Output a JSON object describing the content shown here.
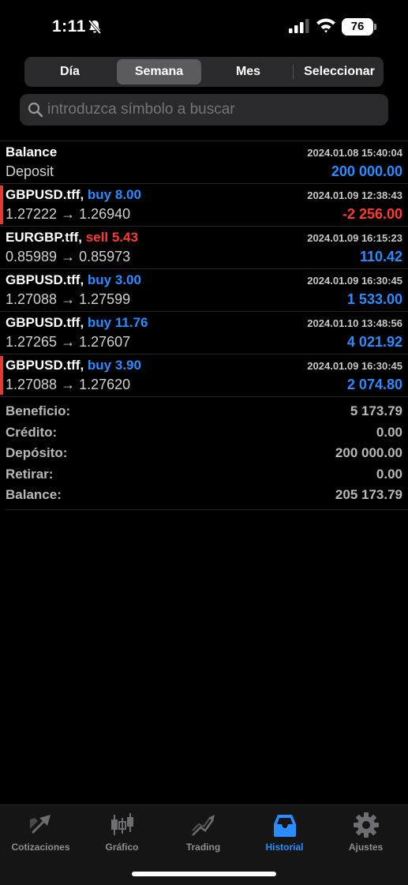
{
  "status": {
    "time": "1:11",
    "battery": "76"
  },
  "segments": [
    {
      "label": "Día"
    },
    {
      "label": "Semana"
    },
    {
      "label": "Mes"
    },
    {
      "label": "Seleccionar"
    }
  ],
  "search": {
    "placeholder": "introduzca símbolo a buscar"
  },
  "history": [
    {
      "symbol": "Balance",
      "action": "",
      "volume": "",
      "sub": "Deposit",
      "date": "2024.01.08 15:40:04",
      "amount": "200 000.00",
      "marker": false
    },
    {
      "symbol": "GBPUSD.tff,",
      "action": "buy",
      "volume": "8.00",
      "sub": "1.27222 → 1.26940",
      "date": "2024.01.09 12:38:43",
      "amount": "-2 256.00",
      "marker": true
    },
    {
      "symbol": "EURGBP.tff,",
      "action": "sell",
      "volume": "5.43",
      "sub": "0.85989 → 0.85973",
      "date": "2024.01.09 16:15:23",
      "amount": "110.42",
      "marker": false
    },
    {
      "symbol": "GBPUSD.tff,",
      "action": "buy",
      "volume": "3.00",
      "sub": "1.27088 → 1.27599",
      "date": "2024.01.09 16:30:45",
      "amount": "1 533.00",
      "marker": false
    },
    {
      "symbol": "GBPUSD.tff,",
      "action": "buy",
      "volume": "11.76",
      "sub": "1.27265 → 1.27607",
      "date": "2024.01.10 13:48:56",
      "amount": "4 021.92",
      "marker": false
    },
    {
      "symbol": "GBPUSD.tff,",
      "action": "buy",
      "volume": "3.90",
      "sub": "1.27088 → 1.27620",
      "date": "2024.01.09 16:30:45",
      "amount": "2 074.80",
      "marker": true
    }
  ],
  "summary": [
    {
      "label": "Beneficio:",
      "value": "5 173.79"
    },
    {
      "label": "Crédito:",
      "value": "0.00"
    },
    {
      "label": "Depósito:",
      "value": "200 000.00"
    },
    {
      "label": "Retirar:",
      "value": "0.00"
    },
    {
      "label": "Balance:",
      "value": "205 173.79"
    }
  ],
  "tabs": [
    {
      "label": "Cotizaciones",
      "icon": "quotes-icon"
    },
    {
      "label": "Gráfico",
      "icon": "candlestick-icon"
    },
    {
      "label": "Trading",
      "icon": "trend-icon"
    },
    {
      "label": "Historial",
      "icon": "inbox-icon"
    },
    {
      "label": "Ajustes",
      "icon": "gear-icon"
    }
  ],
  "colors": {
    "accent": "#2a8cff",
    "loss": "#ff3b30",
    "marker": "#e5382f"
  }
}
